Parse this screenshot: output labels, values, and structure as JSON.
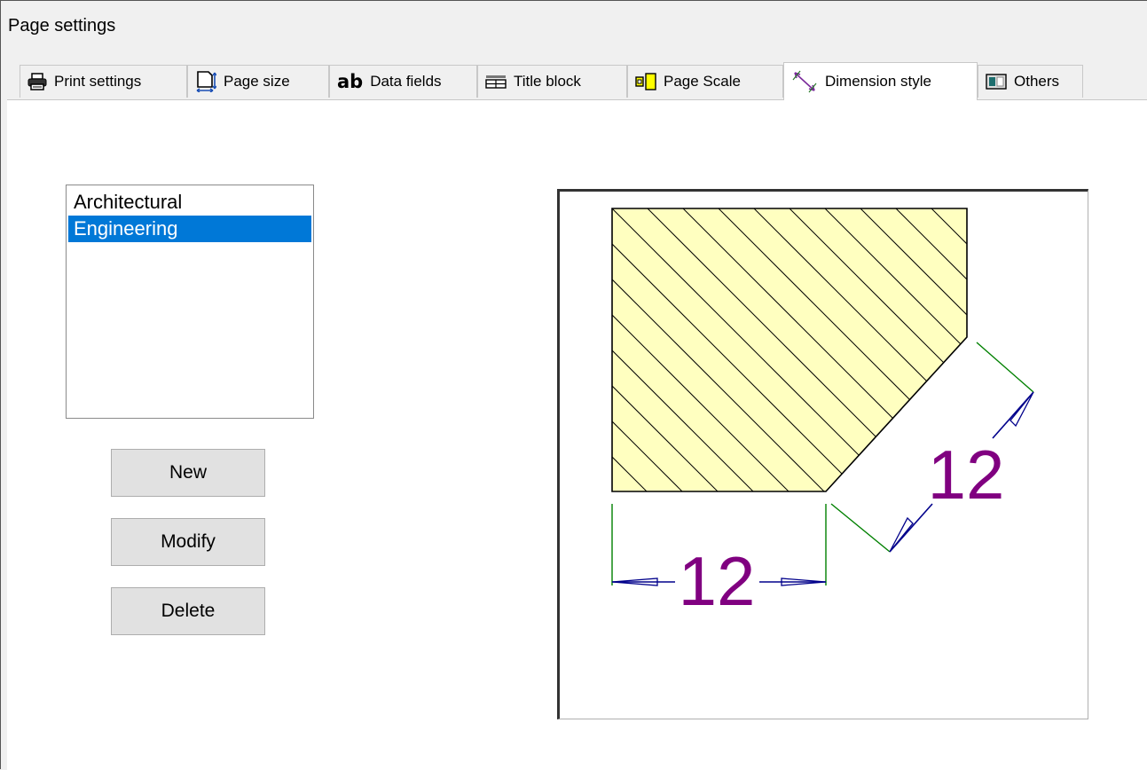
{
  "window": {
    "title": "Page settings"
  },
  "tabs": [
    {
      "label": "Print settings",
      "icon": "printer-icon"
    },
    {
      "label": "Page size",
      "icon": "page-size-icon"
    },
    {
      "label": "Data fields",
      "icon": "ab-text-icon",
      "icon_text": "ab"
    },
    {
      "label": "Title block",
      "icon": "title-block-icon"
    },
    {
      "label": "Page Scale",
      "icon": "page-scale-icon"
    },
    {
      "label": "Dimension style",
      "icon": "dimension-style-icon",
      "active": true
    },
    {
      "label": "Others",
      "icon": "others-icon"
    }
  ],
  "dimension_styles": {
    "items": [
      "Architectural",
      "Engineering"
    ],
    "selected": "Engineering"
  },
  "buttons": {
    "new": "New",
    "modify": "Modify",
    "delete": "Delete"
  },
  "preview": {
    "horizontal_dimension": "12",
    "angled_dimension": "12",
    "colors": {
      "hatch_fill": "#ffffc0",
      "dimension_text": "#800080",
      "dimension_line": "#00008b",
      "extension_line": "#008000"
    }
  },
  "colors": {
    "accent": "#0078d7",
    "window_bg": "#f0f0f0",
    "button_bg": "#e1e1e1"
  }
}
